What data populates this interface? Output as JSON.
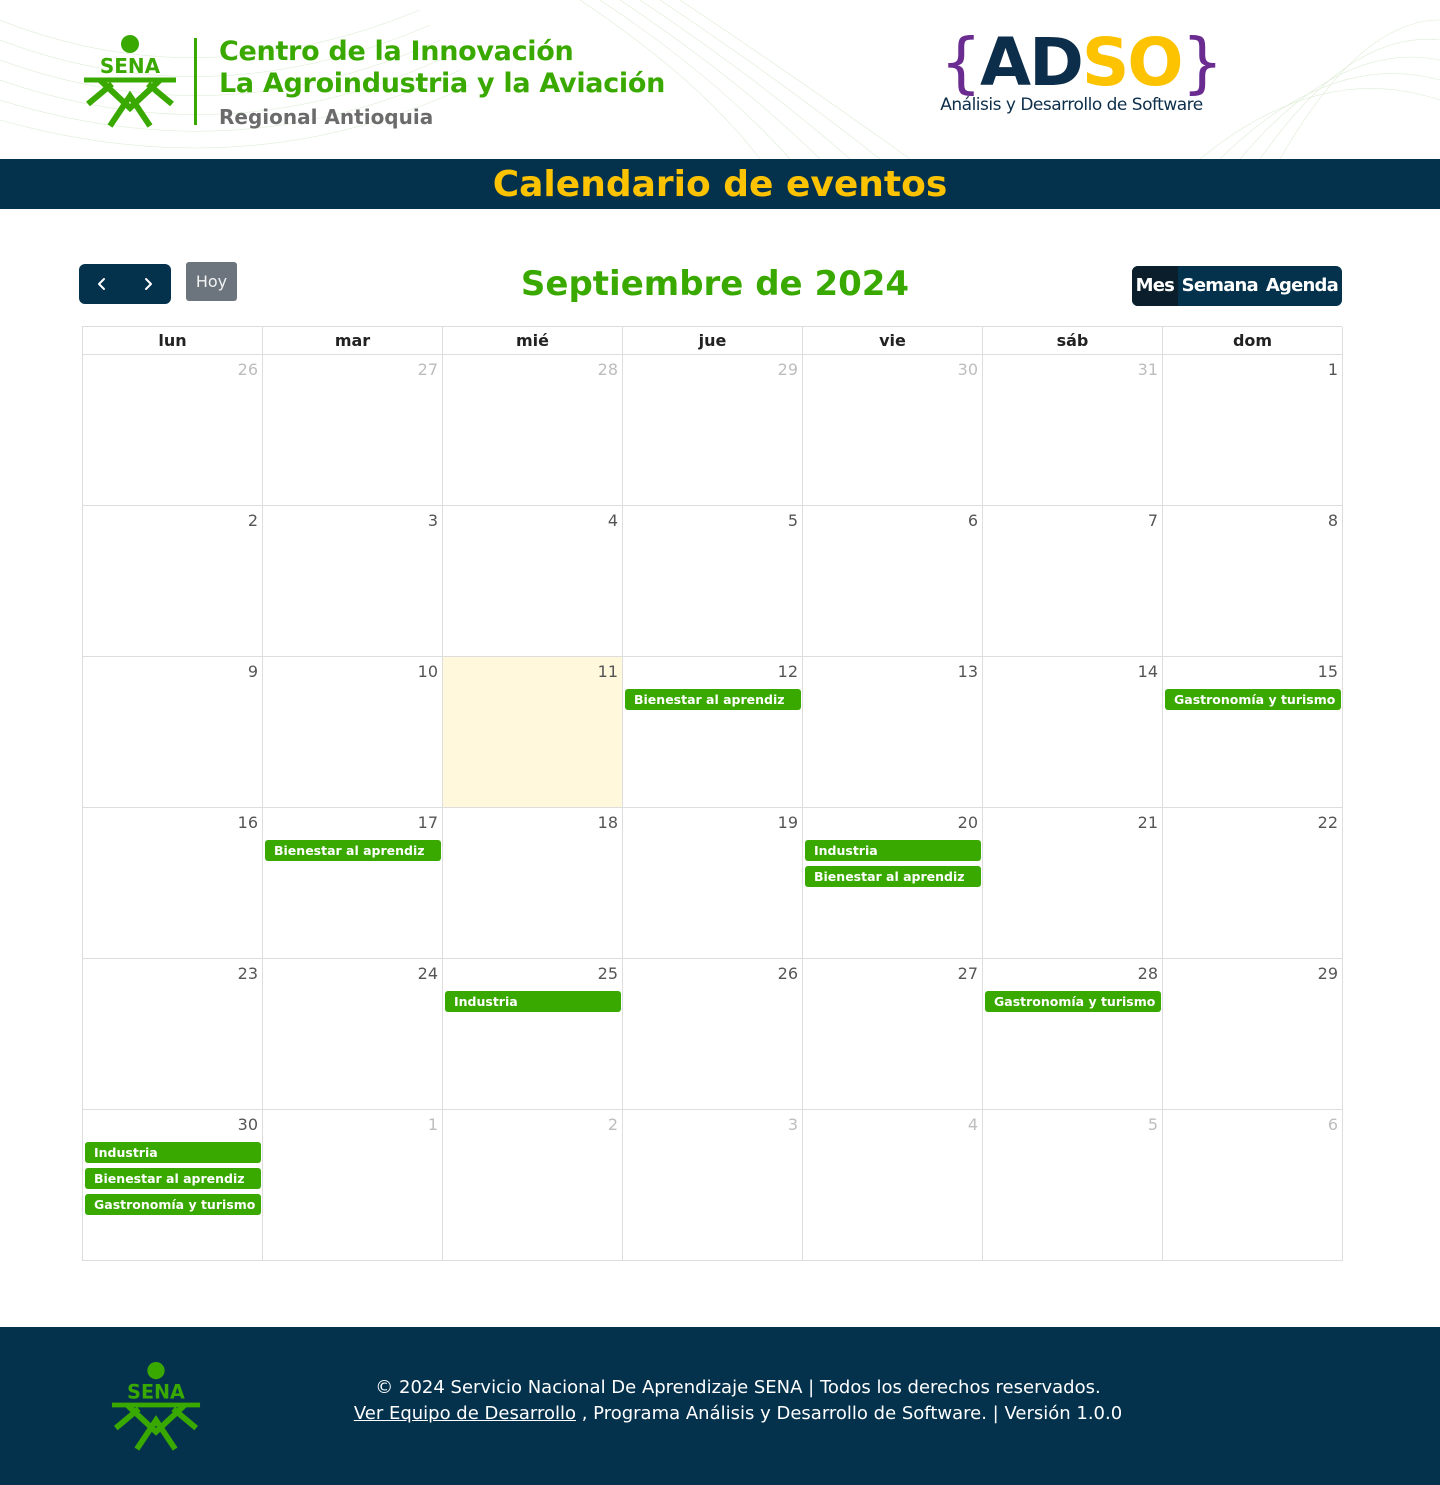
{
  "header": {
    "org_line1": "Centro de la Innovación",
    "org_line2": "La Agroindustria y la Aviación",
    "org_line3": "Regional Antioquia",
    "sena_logo_text": "SENA",
    "adso": {
      "brace_open": "{",
      "ad": "AD",
      "so": "SO",
      "brace_close": "}",
      "subtitle": "Análisis y Desarrollo de Software"
    }
  },
  "page_title": "Calendario de eventos",
  "toolbar": {
    "today_label": "Hoy",
    "month_title": "Septiembre de 2024",
    "views": [
      "Mes",
      "Semana",
      "Agenda"
    ],
    "active_view": "Mes"
  },
  "calendar": {
    "weekdays": [
      "lun",
      "mar",
      "mié",
      "jue",
      "vie",
      "sáb",
      "dom"
    ],
    "today": 11,
    "weeks": [
      [
        {
          "d": "26",
          "o": true
        },
        {
          "d": "27",
          "o": true
        },
        {
          "d": "28",
          "o": true
        },
        {
          "d": "29",
          "o": true
        },
        {
          "d": "30",
          "o": true
        },
        {
          "d": "31",
          "o": true
        },
        {
          "d": "1"
        }
      ],
      [
        {
          "d": "2"
        },
        {
          "d": "3"
        },
        {
          "d": "4"
        },
        {
          "d": "5"
        },
        {
          "d": "6"
        },
        {
          "d": "7"
        },
        {
          "d": "8"
        }
      ],
      [
        {
          "d": "9"
        },
        {
          "d": "10"
        },
        {
          "d": "11",
          "today": true
        },
        {
          "d": "12",
          "events": [
            "Bienestar al aprendiz"
          ]
        },
        {
          "d": "13"
        },
        {
          "d": "14"
        },
        {
          "d": "15",
          "events": [
            "Gastronomía y turismo"
          ]
        }
      ],
      [
        {
          "d": "16"
        },
        {
          "d": "17",
          "events": [
            "Bienestar al aprendiz"
          ]
        },
        {
          "d": "18"
        },
        {
          "d": "19"
        },
        {
          "d": "20",
          "events": [
            "Industria",
            "Bienestar al aprendiz"
          ]
        },
        {
          "d": "21"
        },
        {
          "d": "22"
        }
      ],
      [
        {
          "d": "23"
        },
        {
          "d": "24"
        },
        {
          "d": "25",
          "events": [
            "Industria"
          ]
        },
        {
          "d": "26"
        },
        {
          "d": "27"
        },
        {
          "d": "28",
          "events": [
            "Gastronomía y turismo"
          ]
        },
        {
          "d": "29"
        }
      ],
      [
        {
          "d": "30",
          "events": [
            "Industria",
            "Bienestar al aprendiz",
            "Gastronomía y turismo"
          ]
        },
        {
          "d": "1",
          "o": true
        },
        {
          "d": "2",
          "o": true
        },
        {
          "d": "3",
          "o": true
        },
        {
          "d": "4",
          "o": true
        },
        {
          "d": "5",
          "o": true
        },
        {
          "d": "6",
          "o": true
        }
      ]
    ]
  },
  "footer": {
    "copyright": "© 2024 Servicio Nacional De Aprendizaje SENA | Todos los derechos reservados.",
    "team_link": "Ver Equipo de Desarrollo",
    "program_text": " , Programa Análisis y Desarrollo de Software. | Versión 1.0.0"
  },
  "colors": {
    "sena_green": "#39a900",
    "navy": "#04324d",
    "yellow": "#fdc300",
    "today_bg": "#fff8dd",
    "purple": "#6b2c91"
  },
  "icons": {
    "prev": "chevron-left-icon",
    "next": "chevron-right-icon",
    "logo": "sena-logo-icon"
  }
}
